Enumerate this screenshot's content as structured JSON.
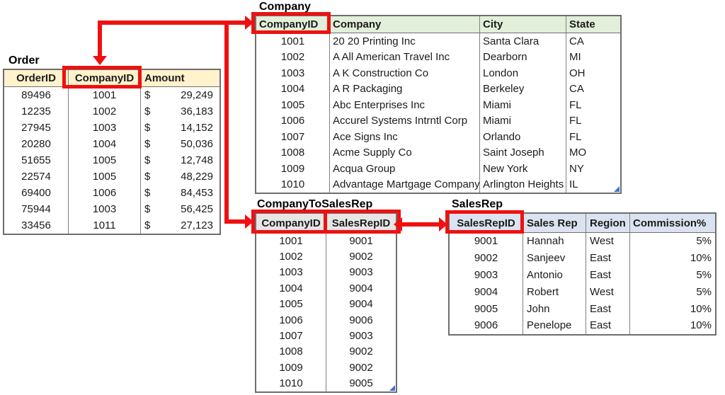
{
  "colors": {
    "arrow_red": "#EE1111",
    "order_header_bg": "#FFF2CC",
    "company_header_bg": "#E2EFDA",
    "mapping_header_bg": "#E7E6E6",
    "salesrep_header_bg": "#DBE3F1",
    "table_border": "#6E6E6E",
    "grid_line": "#808080",
    "text": "#1B1B1B",
    "corner_handle_blue": "#4472C4",
    "background": "#FFFFFF"
  },
  "tables": {
    "order": {
      "title": "Order",
      "columns": [
        "OrderID",
        "CompanyID",
        "Amount"
      ],
      "rows": [
        [
          "89496",
          "1001",
          "$\t29,249"
        ],
        [
          "12235",
          "1002",
          "$\t36,183"
        ],
        [
          "27945",
          "1003",
          "$\t14,152"
        ],
        [
          "20280",
          "1004",
          "$\t50,036"
        ],
        [
          "51655",
          "1005",
          "$\t12,748"
        ],
        [
          "22574",
          "1005",
          "$\t48,229"
        ],
        [
          "69400",
          "1006",
          "$\t84,453"
        ],
        [
          "75944",
          "1003",
          "$\t56,425"
        ],
        [
          "33456",
          "1011",
          "$\t27,123"
        ]
      ]
    },
    "company": {
      "title": "Company",
      "columns": [
        "CompanyID",
        "Company",
        "City",
        "State"
      ],
      "rows": [
        [
          "1001",
          "20 20 Printing Inc",
          "Santa Clara",
          "CA"
        ],
        [
          "1002",
          "A All American Travel Inc",
          "Dearborn",
          "MI"
        ],
        [
          "1003",
          "A K Construction Co",
          "London",
          "OH"
        ],
        [
          "1004",
          "A R Packaging",
          "Berkeley",
          "CA"
        ],
        [
          "1005",
          "Abc Enterprises Inc",
          "Miami",
          "FL"
        ],
        [
          "1006",
          "Accurel Systems Intrntl Corp",
          "Miami",
          "FL"
        ],
        [
          "1007",
          "Ace Signs Inc",
          "Orlando",
          "FL"
        ],
        [
          "1008",
          "Acme Supply Co",
          "Saint Joseph",
          "MO"
        ],
        [
          "1009",
          "Acqua Group",
          "New York",
          "NY"
        ],
        [
          "1010",
          "Advantage Martgage Company",
          "Arlington Heights",
          "IL"
        ]
      ]
    },
    "company_to_salesrep": {
      "title": "CompanyToSalesRep",
      "columns": [
        "CompanyID",
        "SalesRepID"
      ],
      "rows": [
        [
          "1001",
          "9001"
        ],
        [
          "1002",
          "9002"
        ],
        [
          "1003",
          "9003"
        ],
        [
          "1004",
          "9004"
        ],
        [
          "1005",
          "9004"
        ],
        [
          "1006",
          "9006"
        ],
        [
          "1007",
          "9003"
        ],
        [
          "1008",
          "9002"
        ],
        [
          "1009",
          "9002"
        ],
        [
          "1010",
          "9005"
        ]
      ]
    },
    "salesrep": {
      "title": "SalesRep",
      "columns": [
        "SalesRepID",
        "Sales Rep",
        "Region",
        "Commission%"
      ],
      "rows": [
        [
          "9001",
          "Hannah",
          "West",
          "5%"
        ],
        [
          "9002",
          "Sanjeev",
          "East",
          "10%"
        ],
        [
          "9003",
          "Antonio",
          "East",
          "5%"
        ],
        [
          "9004",
          "Robert",
          "West",
          "5%"
        ],
        [
          "9005",
          "John",
          "East",
          "10%"
        ],
        [
          "9006",
          "Penelope",
          "East",
          "10%"
        ]
      ]
    }
  },
  "highlighted_fields": [
    "Order.CompanyID",
    "Company.CompanyID",
    "CompanyToSalesRep.CompanyID",
    "CompanyToSalesRep.SalesRepID",
    "SalesRep.SalesRepID"
  ],
  "relationships": [
    {
      "from": "Company.CompanyID",
      "to": "Order.CompanyID",
      "arrow": "double-headed elbow"
    },
    {
      "from": "Company.CompanyID",
      "to": "CompanyToSalesRep.CompanyID",
      "arrow": "elbow"
    },
    {
      "from": "SalesRep.SalesRepID",
      "to": "CompanyToSalesRep.SalesRepID",
      "arrow": "double-headed"
    }
  ]
}
